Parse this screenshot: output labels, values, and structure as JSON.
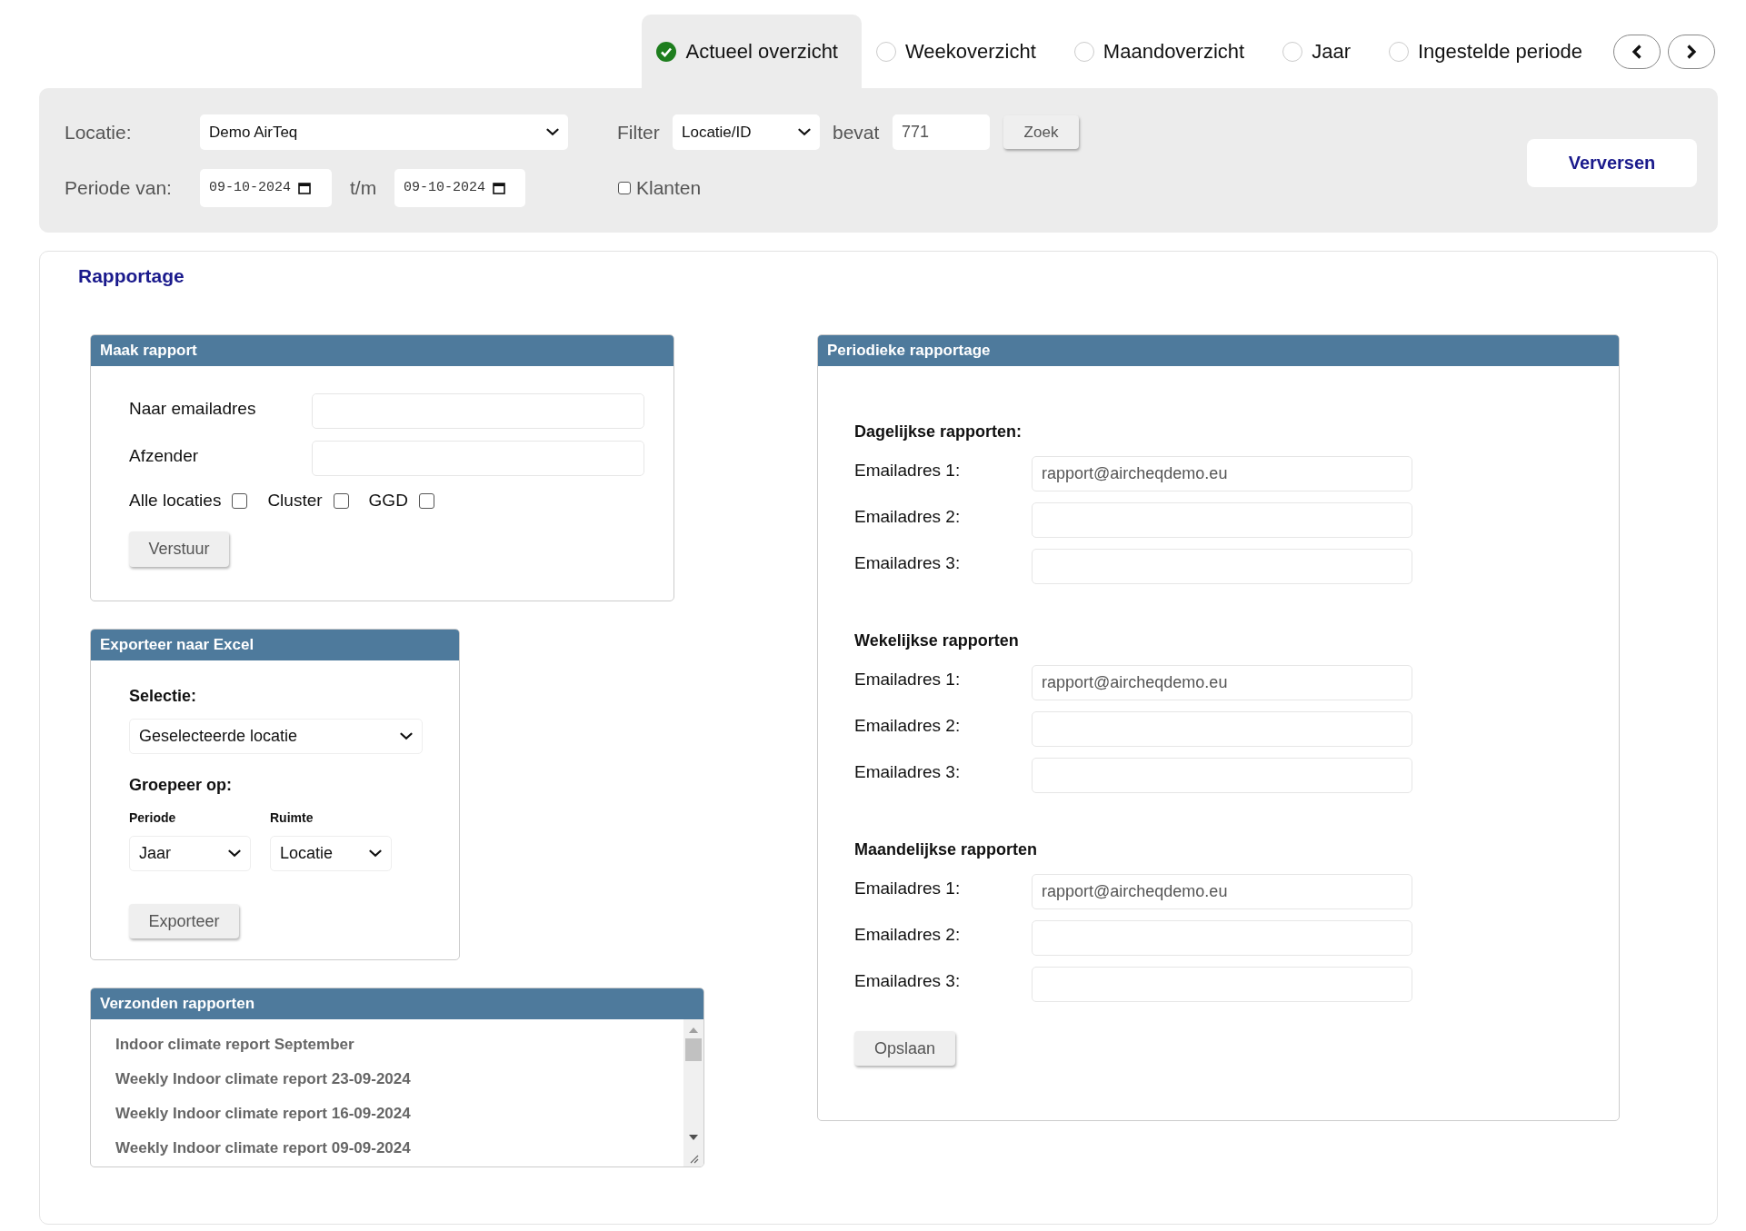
{
  "tabs": [
    {
      "label": "Actueel overzicht",
      "selected": true
    },
    {
      "label": "Weekoverzicht",
      "selected": false
    },
    {
      "label": "Maandoverzicht",
      "selected": false
    },
    {
      "label": "Jaar",
      "selected": false
    },
    {
      "label": "Ingestelde periode",
      "selected": false
    }
  ],
  "filter": {
    "location_label": "Locatie:",
    "location_value": "Demo AirTeq",
    "filter_label": "Filter",
    "filter_value": "Locatie/ID",
    "contains_label": "bevat",
    "search_value": "771",
    "search_button": "Zoek",
    "period_label": "Periode van:",
    "date_from": "09-10-2024",
    "until_label": "t/m",
    "date_to": "09-10-2024",
    "customers": {
      "label": "Klanten",
      "checked": false
    },
    "refresh_button": "Verversen"
  },
  "section_title": "Rapportage",
  "make_report": {
    "title": "Maak rapport",
    "fields": [
      {
        "label": "Naar emailadres"
      },
      {
        "label": "Afzender"
      }
    ],
    "checkboxes": [
      {
        "label": "Alle locaties",
        "checked": false
      },
      {
        "label": "Cluster",
        "checked": false
      },
      {
        "label": "GGD",
        "checked": false
      }
    ],
    "button": "Verstuur"
  },
  "export": {
    "title": "Exporteer naar Excel",
    "selection_label": "Selectie:",
    "selection_value": "Geselecteerde locatie",
    "group_label": "Groepeer op:",
    "period_label": "Periode",
    "period_value": "Jaar",
    "room_label": "Ruimte",
    "room_value": "Locatie",
    "button": "Exporteer"
  },
  "sent_reports": {
    "title": "Verzonden rapporten",
    "items": [
      "Indoor climate report September",
      "Weekly Indoor climate report 23-09-2024",
      "Weekly Indoor climate report 16-09-2024",
      "Weekly Indoor climate report 09-09-2024"
    ]
  },
  "periodic": {
    "title": "Periodieke rapportage",
    "groups": [
      {
        "heading": "Dagelijkse rapporten:",
        "fields": [
          {
            "label": "Emailadres 1:",
            "value": "rapport@aircheqdemo.eu"
          },
          {
            "label": "Emailadres 2:"
          },
          {
            "label": "Emailadres 3:"
          }
        ]
      },
      {
        "heading": "Wekelijkse rapporten",
        "fields": [
          {
            "label": "Emailadres 1:",
            "value": "rapport@aircheqdemo.eu"
          },
          {
            "label": "Emailadres 2:"
          },
          {
            "label": "Emailadres 3:"
          }
        ]
      },
      {
        "heading": "Maandelijkse rapporten",
        "fields": [
          {
            "label": "Emailadres 1:",
            "value": "rapport@aircheqdemo.eu"
          },
          {
            "label": "Emailadres 2:"
          },
          {
            "label": "Emailadres 3:"
          }
        ]
      }
    ],
    "button": "Opslaan"
  }
}
